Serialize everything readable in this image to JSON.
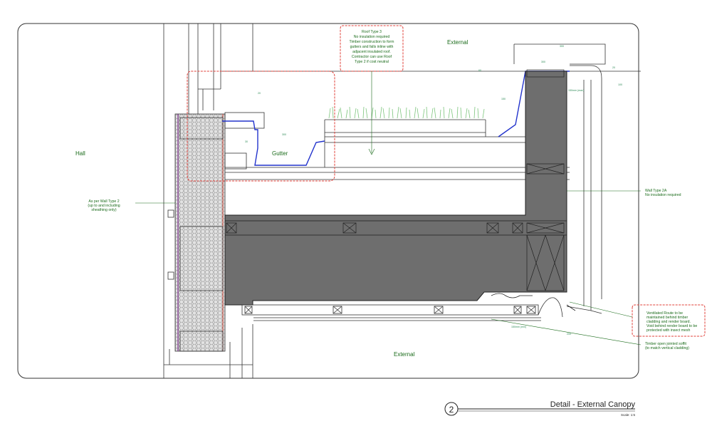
{
  "rooms": {
    "hall": "Hall",
    "external_top": "External",
    "external_bottom": "External",
    "gutter": "Gutter"
  },
  "notes": {
    "roof_type": [
      "Roof Type 3",
      "No insulation required",
      "Timber construction to form",
      "gutters and falls inline with",
      "adjacent insulated roof.",
      "Contractor can use Roof",
      "Type 2 if cost neutral"
    ],
    "wall_type_2": [
      "As per Wall Type 2",
      "(up to and including",
      "sheathing only)"
    ],
    "wall_type_2a": [
      "Wall Type 2A",
      "No insulation required"
    ],
    "ventilated_route": [
      "Ventilated Route to be",
      "maintained behind timber",
      "cladding and render board.",
      "Void behind render board to be",
      "protected with insect mesh"
    ],
    "soffit": [
      "Timber open jointed soffit",
      "(to match vertical cladding)"
    ]
  },
  "dimensions": [
    "300",
    "60",
    "20",
    "150",
    "30",
    "300",
    "20",
    "150mm (max)",
    "300",
    "100",
    "150mm (min)",
    "200"
  ],
  "title_block": {
    "number": "2",
    "title": "Detail - External Canopy",
    "scale": "Scale: 1:5"
  },
  "colors": {
    "annotation": "#1a6b1a",
    "cloud": "#e0403a",
    "membrane": "#2233cc",
    "fill_dark": "#6e6e6e",
    "insulation": "#d8d8d8"
  }
}
